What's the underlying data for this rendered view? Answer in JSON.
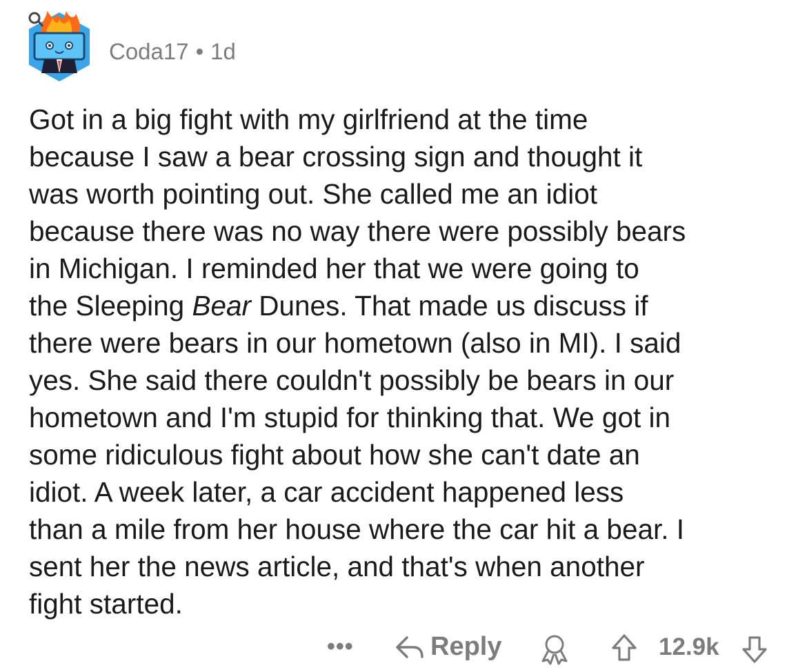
{
  "post": {
    "username": "Coda17",
    "separator": "•",
    "age": "1d",
    "lines": [
      {
        "text": "Got in a big fight with my girlfriend at the time"
      },
      {
        "text": "because I saw a bear crossing sign and thought it"
      },
      {
        "text": "was worth pointing out. She called me an idiot"
      },
      {
        "text": "because there was no way there were possibly bears"
      },
      {
        "text": "in Michigan. I reminded her that we were going to"
      },
      {
        "pre": "the Sleeping ",
        "em": "Bear",
        "post": " Dunes. That made us discuss if"
      },
      {
        "text": "there were bears in our hometown (also in MI). I said"
      },
      {
        "text": "yes. She said there couldn't possibly be bears in our"
      },
      {
        "text": "hometown and I'm stupid for thinking that. We got in"
      },
      {
        "text": "some ridiculous fight about how she can't date an"
      },
      {
        "text": "idiot. A week later, a car accident happened less"
      },
      {
        "text": "than a mile from her house where the car hit a bear. I"
      },
      {
        "text": "sent her the news article, and that's when another"
      },
      {
        "text": "fight started."
      }
    ]
  },
  "actions": {
    "more_label": "•••",
    "reply_label": "Reply",
    "score": "12.9k"
  },
  "icons": {
    "avatar": "snoo-avatar-on-fire",
    "reply": "reply-arrow-icon",
    "award": "award-icon",
    "upvote": "upvote-arrow-icon",
    "downvote": "downvote-arrow-icon"
  },
  "colors": {
    "text": "#1a1a1b",
    "meta": "#7c7c7c",
    "avatar_blue": "#3aa4e8",
    "flame_orange": "#ff6a1a"
  }
}
